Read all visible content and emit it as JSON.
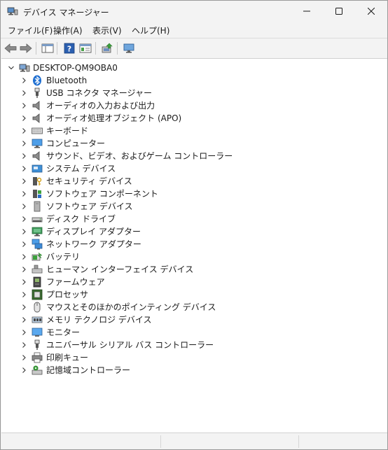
{
  "window": {
    "title": "デバイス マネージャー",
    "icons": {
      "app": "device-manager-icon",
      "minimize": "minimize-icon",
      "maximize": "maximize-icon",
      "close": "close-icon"
    }
  },
  "menu": [
    {
      "label": "ファイル(F)"
    },
    {
      "label": "操作(A)"
    },
    {
      "label": "表示(V)"
    },
    {
      "label": "ヘルプ(H)"
    }
  ],
  "toolbar": [
    {
      "icon": "back-arrow-icon"
    },
    {
      "icon": "forward-arrow-icon"
    },
    {
      "icon": "show-hide-console-tree-icon"
    },
    {
      "icon": "help-icon"
    },
    {
      "icon": "properties-icon"
    },
    {
      "icon": "update-driver-icon"
    },
    {
      "icon": "scan-hardware-icon"
    }
  ],
  "tree": {
    "root": "DESKTOP-QM9OBA0",
    "items": [
      {
        "label": "Bluetooth",
        "icon": "bluetooth-icon"
      },
      {
        "label": "USB コネクタ マネージャー",
        "icon": "usb-connector-icon"
      },
      {
        "label": "オーディオの入力および出力",
        "icon": "speaker-icon"
      },
      {
        "label": "オーディオ処理オブジェクト (APO)",
        "icon": "speaker-icon"
      },
      {
        "label": "キーボード",
        "icon": "keyboard-icon"
      },
      {
        "label": "コンピューター",
        "icon": "computer-icon"
      },
      {
        "label": "サウンド、ビデオ、およびゲーム コントローラー",
        "icon": "speaker-icon"
      },
      {
        "label": "システム デバイス",
        "icon": "system-device-icon"
      },
      {
        "label": "セキュリティ デバイス",
        "icon": "security-device-icon"
      },
      {
        "label": "ソフトウェア コンポーネント",
        "icon": "software-component-icon"
      },
      {
        "label": "ソフトウェア デバイス",
        "icon": "software-device-icon"
      },
      {
        "label": "ディスク ドライブ",
        "icon": "disk-drive-icon"
      },
      {
        "label": "ディスプレイ アダプター",
        "icon": "display-adapter-icon"
      },
      {
        "label": "ネットワーク アダプター",
        "icon": "network-adapter-icon"
      },
      {
        "label": "バッテリ",
        "icon": "battery-icon"
      },
      {
        "label": "ヒューマン インターフェイス デバイス",
        "icon": "hid-icon"
      },
      {
        "label": "ファームウェア",
        "icon": "firmware-icon"
      },
      {
        "label": "プロセッサ",
        "icon": "processor-icon"
      },
      {
        "label": "マウスとそのほかのポインティング デバイス",
        "icon": "mouse-icon"
      },
      {
        "label": "メモリ テクノロジ デバイス",
        "icon": "memory-icon"
      },
      {
        "label": "モニター",
        "icon": "monitor-icon"
      },
      {
        "label": "ユニバーサル シリアル バス コントローラー",
        "icon": "usb-icon"
      },
      {
        "label": "印刷キュー",
        "icon": "printer-icon"
      },
      {
        "label": "記憶域コントローラー",
        "icon": "storage-controller-icon"
      }
    ]
  },
  "colors": {
    "accent": "#1a73c7",
    "window_bg": "#f3f3f3",
    "tree_bg": "#ffffff"
  }
}
